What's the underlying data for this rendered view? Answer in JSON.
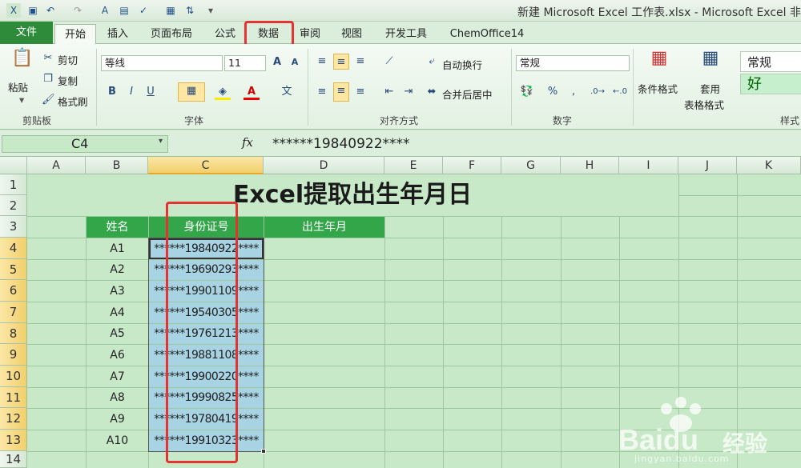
{
  "window": {
    "title": "新建 Microsoft Excel 工作表.xlsx - Microsoft Excel 非"
  },
  "tabs": [
    "文件",
    "开始",
    "插入",
    "页面布局",
    "公式",
    "数据",
    "审阅",
    "视图",
    "开发工具",
    "ChemOffice14"
  ],
  "ribbon": {
    "clipboard": {
      "paste": "粘贴",
      "cut": "剪切",
      "copy": "复制",
      "format_painter": "格式刷",
      "label": "剪贴板"
    },
    "font": {
      "name": "等线",
      "size": "11",
      "label": "字体"
    },
    "alignment": {
      "wrap": "自动换行",
      "merge": "合并后居中",
      "label": "对齐方式"
    },
    "number": {
      "format": "常规",
      "label": "数字"
    },
    "styles": {
      "conditional": "条件格式",
      "table_line1": "套用",
      "table_line2": "表格格式",
      "normal": "常规",
      "good": "好",
      "label": "样式"
    }
  },
  "formula_bar": {
    "name_box": "C4",
    "fx": "fx",
    "value": "******19840922****"
  },
  "columns": [
    "A",
    "B",
    "C",
    "D",
    "E",
    "F",
    "G",
    "H",
    "I",
    "J",
    "K"
  ],
  "rows": [
    "1",
    "2",
    "3",
    "4",
    "5",
    "6",
    "7",
    "8",
    "9",
    "10",
    "11",
    "12",
    "13",
    "14"
  ],
  "sheet": {
    "title": "Excel提取出生年月日",
    "headers": {
      "name": "姓名",
      "id": "身份证号",
      "birth": "出生年月"
    },
    "records": [
      {
        "name": "A1",
        "id": "******19840922****"
      },
      {
        "name": "A2",
        "id": "******19690293****"
      },
      {
        "name": "A3",
        "id": "******19901109****"
      },
      {
        "name": "A4",
        "id": "******19540305****"
      },
      {
        "name": "A5",
        "id": "******19761213****"
      },
      {
        "name": "A6",
        "id": "******19881108****"
      },
      {
        "name": "A7",
        "id": "******19900220****"
      },
      {
        "name": "A8",
        "id": "******19990825****"
      },
      {
        "name": "A9",
        "id": "******19780419****"
      },
      {
        "name": "A10",
        "id": "******19910323****"
      }
    ]
  },
  "watermark": {
    "brand": "Baidu",
    "cn": "经验",
    "url": "jingyan.baidu.com"
  },
  "colors": {
    "accent_green": "#33a64a",
    "highlight_red": "#e53333",
    "selection_blue": "#a7d3e3"
  }
}
